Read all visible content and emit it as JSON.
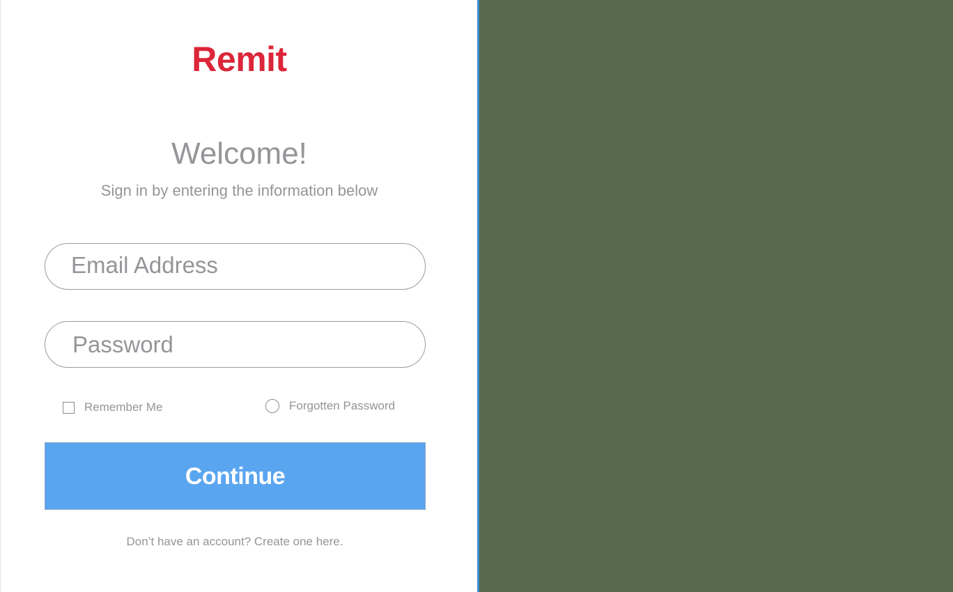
{
  "brand": {
    "name": "Remit",
    "color": "#dc2639"
  },
  "header": {
    "title": "Welcome!",
    "subtitle": "Sign in by entering the information below"
  },
  "form": {
    "email_placeholder": "Email Address",
    "email_value": "",
    "password_placeholder": "Password",
    "password_value": "",
    "remember_label": "Remember Me",
    "remember_checked": false,
    "forgot_label": "Forgotten Password",
    "continue_label": "Continue",
    "signup_text": "Don’t have an account? Create one here."
  },
  "colors": {
    "accent": "#5aa5f0",
    "side_panel": "#56694c",
    "divider": "#3b8fd0",
    "muted_text": "#939598"
  }
}
